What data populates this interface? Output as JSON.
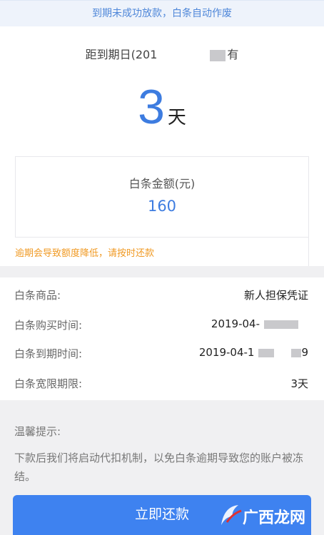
{
  "notice": "到期未成功放款，白条自动作废",
  "countdown": {
    "label_prefix": "距到期日(201",
    "label_suffix": "有",
    "days": "3",
    "unit": "天"
  },
  "amount": {
    "label": "白条金额(元)",
    "value": "160"
  },
  "warning": "逾期会导致额度降低，请按时还款",
  "details": [
    {
      "label": "白条商品:",
      "value": "新人担保凭证"
    },
    {
      "label": "白条购买时间:",
      "value": "2019-04-"
    },
    {
      "label": "白条到期时间:",
      "value": "2019-04-1",
      "value_tail": "9"
    },
    {
      "label": "白条宽限期限:",
      "value": "3天"
    }
  ],
  "tips": {
    "title": "温馨提示:",
    "body": "下款后我们将启动代扣机制，以免白条逾期导致您的账户被冻结。"
  },
  "pay_button": "立即还款",
  "watermark": "广西龙网",
  "colors": {
    "accent": "#3e82f0",
    "warning": "#f09a24"
  }
}
